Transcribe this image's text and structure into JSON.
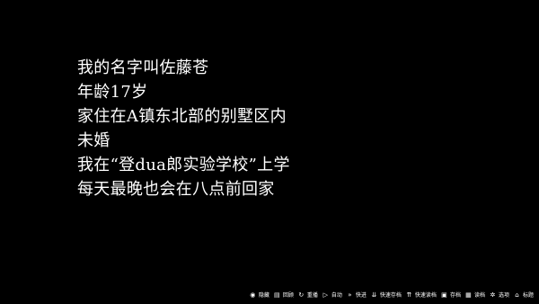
{
  "narration": {
    "lines": [
      "我的名字叫佐藤苍",
      "年龄17岁",
      "家住在A镇东北部的别墅区内",
      "未婚",
      "我在“登dua郎实验学校”上学",
      "每天最晚也会在八点前回家"
    ],
    "text_color": "#ffffff",
    "background_color": "#000000"
  },
  "toolbar": {
    "items": [
      {
        "name": "hide",
        "label": "隐藏",
        "icon": "eye-off-icon",
        "glyph": "◉"
      },
      {
        "name": "history",
        "label": "回顾",
        "icon": "history-icon",
        "glyph": "▤"
      },
      {
        "name": "replay",
        "label": "重播",
        "icon": "replay-icon",
        "glyph": "↻"
      },
      {
        "name": "auto",
        "label": "自动",
        "icon": "auto-play-icon",
        "glyph": "▷"
      },
      {
        "name": "skip",
        "label": "快进",
        "icon": "fast-forward-icon",
        "glyph": "»"
      },
      {
        "name": "quick-save",
        "label": "快速存档",
        "icon": "quick-save-icon",
        "glyph": "⇊"
      },
      {
        "name": "quick-load",
        "label": "快速读档",
        "icon": "quick-load-icon",
        "glyph": "⇈"
      },
      {
        "name": "save",
        "label": "存档",
        "icon": "save-icon",
        "glyph": "▣"
      },
      {
        "name": "load",
        "label": "读档",
        "icon": "load-icon",
        "glyph": "▦"
      },
      {
        "name": "options",
        "label": "选项",
        "icon": "gear-icon",
        "glyph": "✲"
      },
      {
        "name": "title",
        "label": "标题",
        "icon": "home-icon",
        "glyph": "⌂"
      }
    ]
  }
}
